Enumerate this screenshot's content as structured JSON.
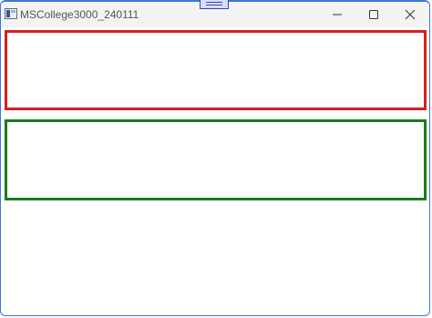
{
  "window": {
    "title": "MSCollege3000_240111",
    "controls": {
      "minimize_icon": "minimize-icon",
      "maximize_icon": "maximize-icon",
      "close_icon": "close-icon"
    }
  },
  "colors": {
    "accent_border": "#3b78d8",
    "red_box": "#d61f1f",
    "green_box": "#1a7d1a",
    "drag_handle": "#3a44b8"
  }
}
